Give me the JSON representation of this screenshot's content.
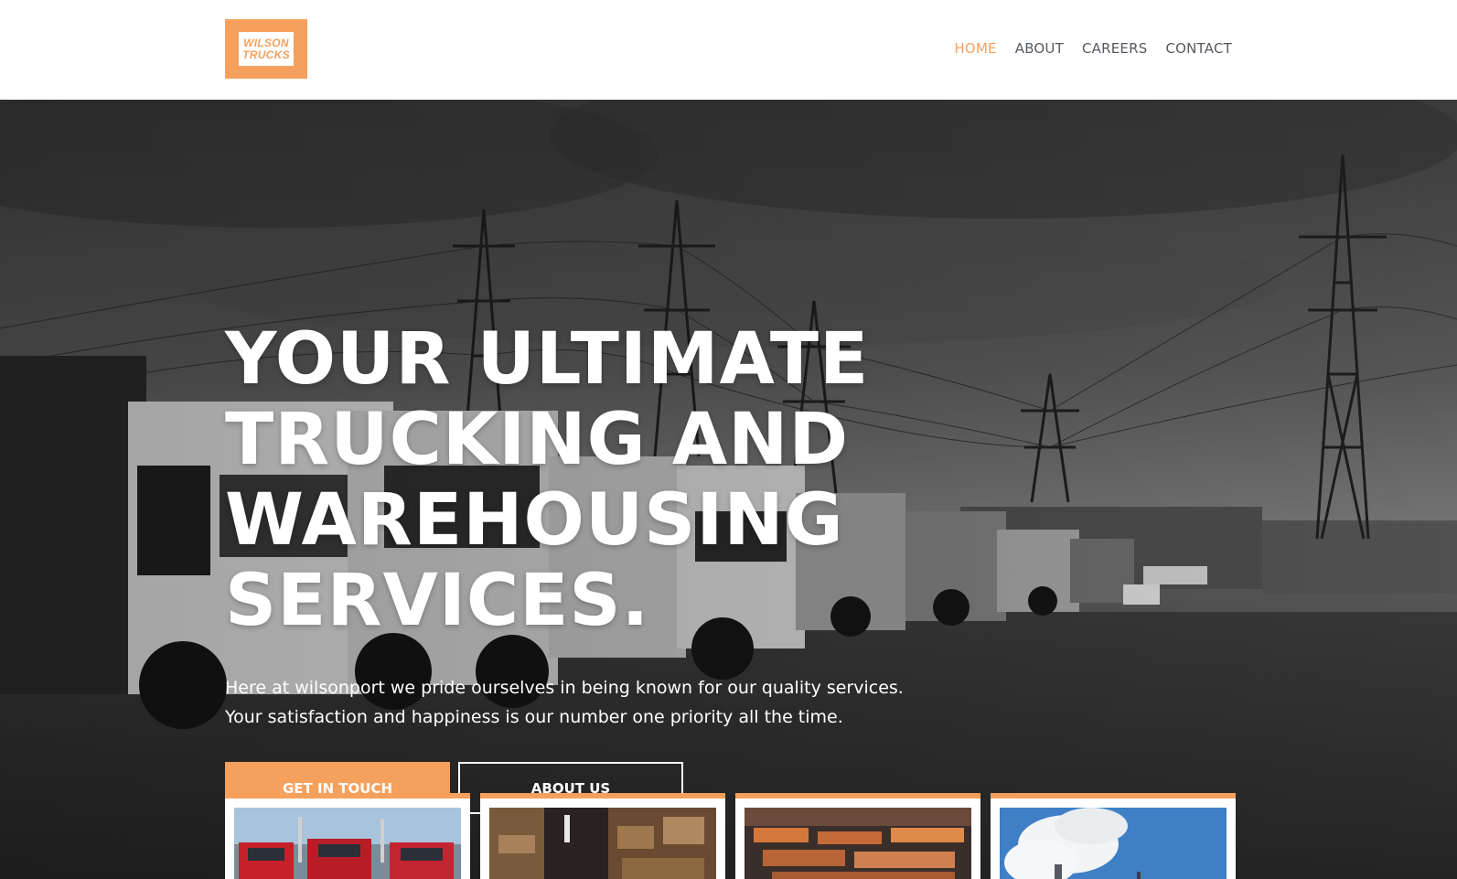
{
  "header": {
    "logo": {
      "line1": "WILSON",
      "line2": "TRUCKS"
    },
    "nav": [
      {
        "label": "HOME",
        "active": true
      },
      {
        "label": "ABOUT",
        "active": false
      },
      {
        "label": "CAREERS",
        "active": false
      },
      {
        "label": "CONTACT",
        "active": false
      }
    ]
  },
  "hero": {
    "headline": "YOUR ULTIMATE TRUCKING AND WAREHOUSING SERVICES.",
    "intro": "Here at wilsonport we pride ourselves in being known for our quality services. Your satisfaction and happiness is our number one priority all the time.",
    "primary_button": "GET IN TOUCH",
    "secondary_button": "ABOUT US"
  },
  "cards": [
    {
      "image": "red-trucks-photo"
    },
    {
      "image": "warehouse-shelves-photo"
    },
    {
      "image": "container-port-photo"
    },
    {
      "image": "factory-smoke-photo"
    }
  ],
  "colors": {
    "accent": "#f5a05c",
    "nav_text": "#555a60",
    "hero_text": "#ffffff"
  }
}
